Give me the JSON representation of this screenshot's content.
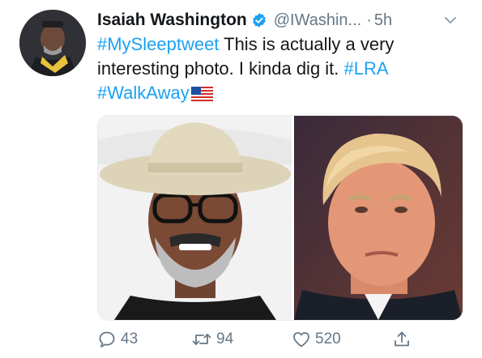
{
  "tweet": {
    "author_name": "Isaiah Washington",
    "handle": "@IWashin...",
    "separator": "·",
    "time": "5h",
    "segments": [
      {
        "text": "#MySleeptweet",
        "type": "tag"
      },
      {
        "text": " This is actually a very interesting photo. I kinda dig it. ",
        "type": "plain"
      },
      {
        "text": "#LRA",
        "type": "tag"
      },
      {
        "text": " ",
        "type": "plain"
      },
      {
        "text": "#WalkAway",
        "type": "tag"
      }
    ]
  },
  "actions": {
    "replies": "43",
    "retweets": "94",
    "likes": "520"
  },
  "colors": {
    "accent": "#1da1f2",
    "secondary_text": "#657786",
    "primary_text": "#14171a"
  },
  "icons": [
    "verified-badge-icon",
    "chevron-down-icon",
    "us-flag-emoji",
    "reply-icon",
    "retweet-icon",
    "like-icon",
    "share-icon"
  ]
}
